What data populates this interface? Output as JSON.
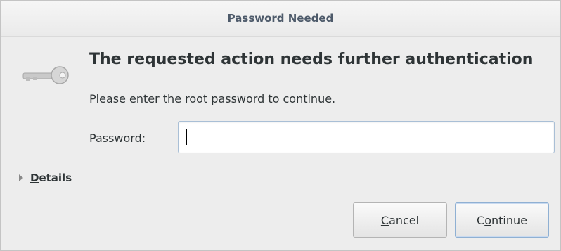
{
  "window": {
    "title": "Password Needed"
  },
  "icon": "key-icon",
  "heading": "The requested action needs further authentication",
  "message": "Please enter the root password to continue.",
  "password": {
    "label_mnemonic": "P",
    "label_rest": "assword:",
    "value": "",
    "placeholder": ""
  },
  "details": {
    "label_mnemonic": "D",
    "label_rest": "etails",
    "expanded": false
  },
  "buttons": {
    "cancel": {
      "mnemonic": "C",
      "rest": "ancel"
    },
    "continue": {
      "before": "C",
      "mnemonic": "o",
      "rest": "ntinue"
    }
  }
}
